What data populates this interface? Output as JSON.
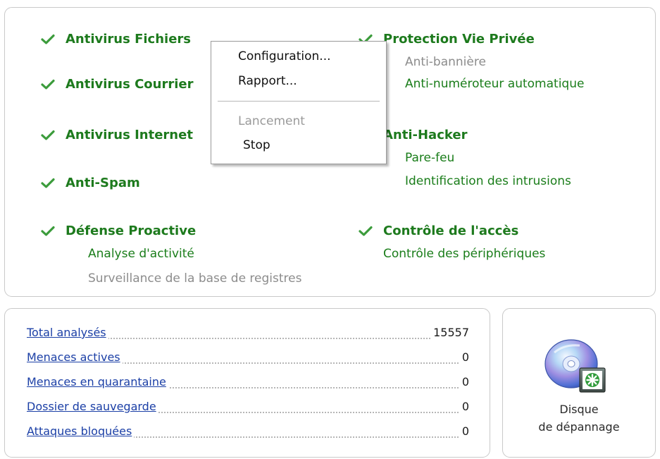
{
  "colors": {
    "enabled_green": "#1d7a1d",
    "disabled_gray": "#8c8c8c",
    "link_blue": "#1b3fa6"
  },
  "protection": {
    "av_files": {
      "title": "Antivirus Fichiers",
      "icon": "checkmark-icon"
    },
    "av_mail": {
      "title": "Antivirus Courrier",
      "icon": "checkmark-icon"
    },
    "av_web": {
      "title": "Antivirus Internet",
      "icon": "checkmark-icon"
    },
    "anti_spam": {
      "title": "Anti-Spam",
      "icon": "checkmark-icon"
    },
    "proactive": {
      "title": "Défense Proactive",
      "icon": "checkmark-icon",
      "sub": [
        "Analyse d'activité",
        "Surveillance de la base de registres"
      ]
    },
    "privacy": {
      "title": "Protection Vie Privée",
      "icon": "checkmark-icon",
      "sub": [
        "Anti-bannière",
        "Anti-numéroteur automatique"
      ]
    },
    "anti_hacker": {
      "title": "Anti-Hacker",
      "sub": [
        "Pare-feu",
        "Identification des intrusions"
      ]
    },
    "access": {
      "title": "Contrôle de l'accès",
      "icon": "checkmark-icon",
      "sub": [
        "Contrôle des périphériques"
      ]
    }
  },
  "context_menu": {
    "items": [
      "Configuration...",
      "Rapport...",
      "Lancement",
      "Stop"
    ],
    "disabled": [
      "Lancement"
    ]
  },
  "stats": {
    "rows": [
      {
        "label": "Total analysés",
        "value": "15557"
      },
      {
        "label": "Menaces actives",
        "value": "0"
      },
      {
        "label": "Menaces en quarantaine",
        "value": "0"
      },
      {
        "label": "Dossier de sauvegarde",
        "value": "0"
      },
      {
        "label": "Attaques bloquées",
        "value": "0"
      }
    ]
  },
  "rescue_disk": {
    "label": "Disque\nde dépannage",
    "icon": "rescue-disk-icon"
  }
}
